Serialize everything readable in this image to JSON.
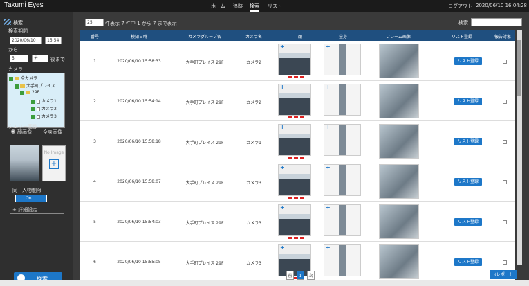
{
  "app": {
    "brand": "Takumi Eyes",
    "datetime": "2020/06/10 16:04:28",
    "logout": "ログアウト"
  },
  "nav": [
    {
      "label": "ホーム",
      "active": false
    },
    {
      "label": "追跡",
      "active": false
    },
    {
      "label": "検索",
      "active": true
    },
    {
      "label": "リスト",
      "active": false
    }
  ],
  "left": {
    "title": "検索",
    "period_label": "検索期間",
    "date_value": "2020/06/10",
    "time_value": "15:54",
    "from_label": "から",
    "amount_value": "5",
    "unit_value": "分",
    "after_label": "後まで",
    "camera_label": "カメラ",
    "tree": [
      {
        "level": 0,
        "label": "全カメラ",
        "kind": "folder"
      },
      {
        "level": 1,
        "label": "大手町プレイス",
        "kind": "folder"
      },
      {
        "level": 2,
        "label": "29F",
        "kind": "folder"
      },
      {
        "level": 3,
        "label": "カメラ1",
        "kind": "cam"
      },
      {
        "level": 3,
        "label": "カメラ2",
        "kind": "cam"
      },
      {
        "level": 3,
        "label": "カメラ3",
        "kind": "cam"
      }
    ],
    "query_label": "クエリー画像",
    "face_label": "顔画像",
    "body_label": "全身画像",
    "no_image_label": "No Image",
    "same_person_label": "同一人物制限",
    "toggle_value": "On",
    "advanced_label": "詳細設定",
    "search_button": "検索"
  },
  "toolbar": {
    "page_size": "25",
    "summary": "件表示   7 件中 1 から 7 まで表示",
    "search_label": "検索",
    "search_placeholder": ""
  },
  "table": {
    "headers": [
      "番号",
      "検知日時",
      "カメラグループ名",
      "カメラ名",
      "顔",
      "全身",
      "フレーム画像",
      "リスト登録",
      "報告対象"
    ],
    "rows": [
      {
        "no": "1",
        "datetime": "2020/06/10 15:58:33",
        "group": "大手町プレイス 29F",
        "camera": "カメラ2"
      },
      {
        "no": "2",
        "datetime": "2020/06/10 15:54:14",
        "group": "大手町プレイス 29F",
        "camera": "カメラ2"
      },
      {
        "no": "3",
        "datetime": "2020/06/10 15:58:18",
        "group": "大手町プレイス 29F",
        "camera": "カメラ1"
      },
      {
        "no": "4",
        "datetime": "2020/06/10 15:58:07",
        "group": "大手町プレイス 29F",
        "camera": "カメラ3"
      },
      {
        "no": "5",
        "datetime": "2020/06/10 15:54:03",
        "group": "大手町プレイス 29F",
        "camera": "カメラ3"
      },
      {
        "no": "6",
        "datetime": "2020/06/10 15:55:05",
        "group": "大手町プレイス 29F",
        "camera": "カメラ3"
      }
    ],
    "list_button": "リスト登録"
  },
  "pager": {
    "prev": "前",
    "current": "1",
    "next": "次"
  },
  "report_button": "レポート"
}
